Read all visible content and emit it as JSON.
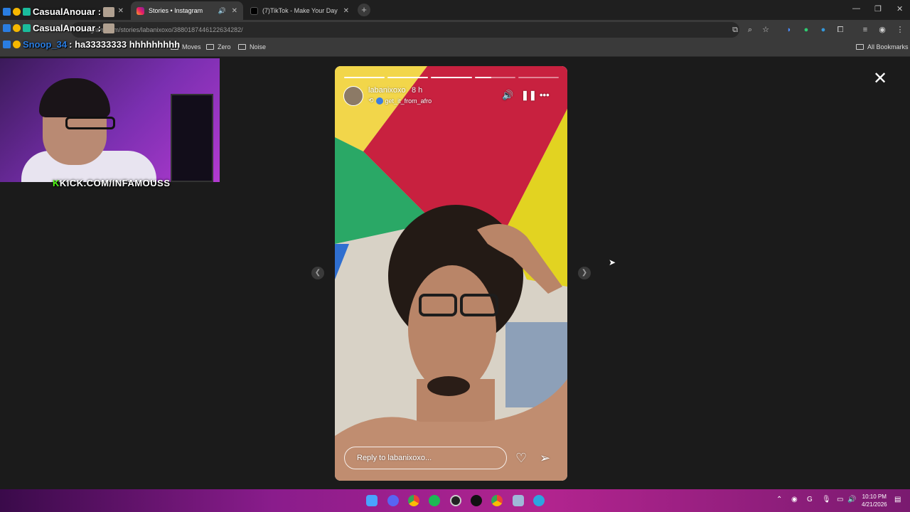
{
  "browser": {
    "tabs": [
      {
        "label": "",
        "active": false
      },
      {
        "label": "Stories • Instagram",
        "active": true
      },
      {
        "label": "(7)TikTok - Make Your Day",
        "active": false
      }
    ],
    "address": "instagram.com/stories/labanixoxo/3880187446122634282/",
    "bookmarks": [
      "Moves",
      "Zero",
      "Noise"
    ],
    "all_bookmarks": "All Bookmarks"
  },
  "overlay_chat": [
    {
      "user": "CasualAnouar :",
      "message": ""
    },
    {
      "user": "CasualAnouar :",
      "message": ""
    },
    {
      "user": "Snoop_34",
      "message": ": ha33333333 hhhhhhhhh"
    }
  ],
  "webcam": {
    "caption_prefix": "K",
    "caption": "KICK.COM/INFAMOUSS"
  },
  "story": {
    "username": "labanixoxo",
    "time": "8 h",
    "reposted_from": "get_it_from_afro",
    "reply_placeholder": "Reply to labanixoxo...",
    "progress_segments": 5,
    "progress_current": 4,
    "progress_current_fraction": 0.4
  },
  "taskbar": {
    "time": "10:10 PM",
    "date": "4/21/2026"
  },
  "colors": {
    "kick_green": "#53fc18",
    "taskbar_purple": "#8a1c8c"
  }
}
